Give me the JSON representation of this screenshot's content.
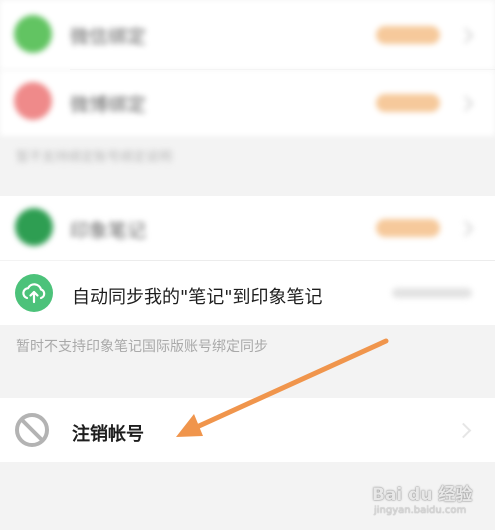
{
  "settings": {
    "items": [
      {
        "label": "微信绑定",
        "status": "已绑定",
        "icon": "wechat-icon",
        "color": "#62c462"
      },
      {
        "label": "微博绑定",
        "status": "未绑定",
        "icon": "weibo-icon",
        "color": "#ef8a8a"
      },
      {
        "label": "印象笔记",
        "status": "未绑定",
        "icon": "evernote-icon",
        "color": "#2e9e52"
      }
    ],
    "section_note": "暂不支持绑定账号绑定说明",
    "sync_label": "自动同步我的\"笔记\"到印象笔记",
    "sync_icon": "cloud-upload-icon",
    "sync_icon_color": "#4cc27a",
    "intl_note": "暂时不支持印象笔记国际版账号绑定同步",
    "logout_label": "注销帐号",
    "logout_icon": "ban-icon",
    "accent_arrow_color": "#f0954c"
  },
  "watermark": {
    "text": "Bai du 经验",
    "sub": "jingyan.baidu.com"
  }
}
